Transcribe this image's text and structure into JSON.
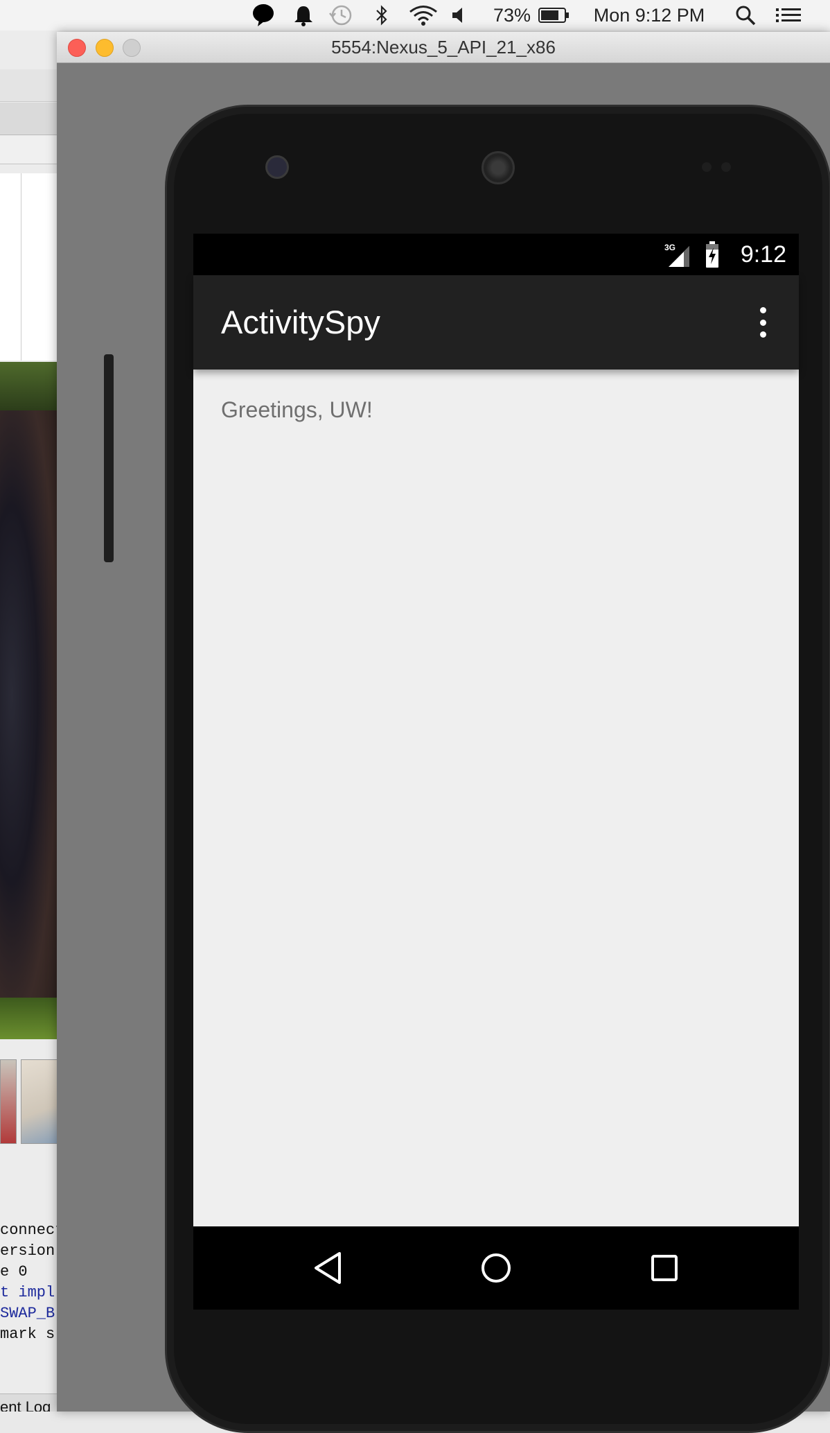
{
  "menubar": {
    "battery_percent": "73%",
    "clock": "Mon 9:12 PM",
    "icons": [
      "speech-bubble-icon",
      "notification-bell-icon",
      "time-machine-icon",
      "bluetooth-icon",
      "wifi-icon",
      "volume-icon",
      "battery-icon",
      "spotlight-search-icon",
      "notification-center-icon"
    ]
  },
  "background_app": {
    "code_lines": [
      "connect",
      "ersion",
      "e 0",
      "t impl",
      "SWAP_B",
      "mark s"
    ],
    "event_log_tab": "ent Log"
  },
  "emulator_window": {
    "title": "5554:Nexus_5_API_21_x86"
  },
  "android": {
    "statusbar": {
      "network": "3G",
      "time": "9:12"
    },
    "appbar": {
      "title": "ActivitySpy"
    },
    "content": {
      "greeting": "Greetings, UW!"
    },
    "navbar": [
      "back-icon",
      "home-icon",
      "recents-icon"
    ]
  }
}
